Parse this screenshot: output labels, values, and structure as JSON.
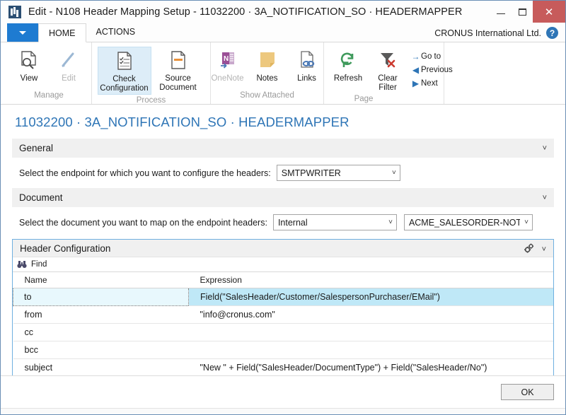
{
  "window": {
    "title": "Edit - N108 Header Mapping Setup - 11032200 · 3A_NOTIFICATION_SO · HEADERMAPPER",
    "app_icon": "nav-app-icon",
    "minimize_label": "Minimize",
    "maximize_label": "Maximize",
    "close_label": "Close"
  },
  "tabstrip": {
    "quick_access_label": "",
    "tabs": [
      {
        "label": "HOME",
        "active": true
      },
      {
        "label": "ACTIONS",
        "active": false
      }
    ],
    "company": "CRONUS International Ltd.",
    "help_glyph": "?"
  },
  "ribbon": {
    "groups": [
      {
        "label": "Manage",
        "buttons": [
          {
            "label": "View",
            "icon": "view-page-icon",
            "state": "normal"
          },
          {
            "label": "Edit",
            "icon": "edit-pencil-icon",
            "state": "disabled"
          }
        ]
      },
      {
        "label": "Process",
        "buttons": [
          {
            "label": "Check Configuration",
            "icon": "check-configuration-icon",
            "state": "selected"
          },
          {
            "label": "Source Document",
            "icon": "source-document-icon",
            "state": "normal"
          }
        ]
      },
      {
        "label": "Show Attached",
        "buttons": [
          {
            "label": "OneNote",
            "icon": "onenote-icon",
            "state": "disabled"
          },
          {
            "label": "Notes",
            "icon": "notes-icon",
            "state": "normal"
          },
          {
            "label": "Links",
            "icon": "links-icon",
            "state": "normal"
          }
        ]
      },
      {
        "label": "Page",
        "buttons": [
          {
            "label": "Refresh",
            "icon": "refresh-icon",
            "state": "normal"
          },
          {
            "label": "Clear Filter",
            "icon": "clear-filter-icon",
            "state": "normal"
          }
        ],
        "small_buttons": [
          {
            "label": "Go to",
            "icon": "goto-arrow-icon"
          },
          {
            "label": "Previous",
            "icon": "previous-arrow-icon"
          },
          {
            "label": "Next",
            "icon": "next-arrow-icon"
          }
        ]
      }
    ]
  },
  "page": {
    "title": "11032200 · 3A_NOTIFICATION_SO · HEADERMAPPER"
  },
  "general": {
    "header": "General",
    "endpoint_label": "Select the endpoint for which you want to configure the headers:",
    "endpoint_value": "SMTPWRITER"
  },
  "document": {
    "header": "Document",
    "doc_label": "Select the document you want to map on the endpoint headers:",
    "doc_type_value": "Internal",
    "doc_name_value": "ACME_SALESORDER-NOT"
  },
  "header_configuration": {
    "header": "Header Configuration",
    "find_label": "Find",
    "find_icon": "binoculars-icon",
    "gears_icon": "configure-gears-icon",
    "columns": [
      "Name",
      "Expression"
    ],
    "rows": [
      {
        "name": "to",
        "expression": "Field(\"SalesHeader/Customer/SalespersonPurchaser/EMail\")",
        "selected": true
      },
      {
        "name": "from",
        "expression": "\"info@cronus.com\"",
        "selected": false
      },
      {
        "name": "cc",
        "expression": "",
        "selected": false
      },
      {
        "name": "bcc",
        "expression": "",
        "selected": false
      },
      {
        "name": "subject",
        "expression": "\"New \" + Field(\"SalesHeader/DocumentType\") + Field(\"SalesHeader/No\")",
        "selected": false
      }
    ]
  },
  "footer": {
    "ok_label": "OK"
  },
  "colors": {
    "accent_blue": "#2e75b6",
    "close_red": "#c75b5b",
    "quick_access_blue": "#1e7bd1",
    "selected_row": "#bfe8f7",
    "group_header": "#f0f0f0",
    "ribbon_selected": "#ddedf8"
  }
}
